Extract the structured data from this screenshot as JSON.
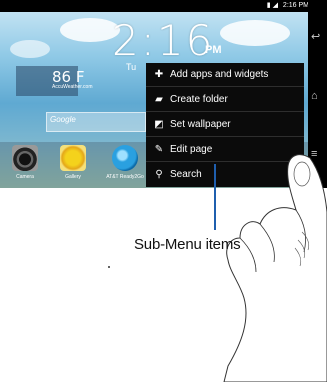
{
  "status_bar": {
    "time": "2:16 PM"
  },
  "home": {
    "clock": "2:16",
    "ampm": "PM",
    "date_fragment": "Tu",
    "temperature": "86 F",
    "weather_source": "AccuWeather.com",
    "google_label": "Google"
  },
  "dock_apps": [
    {
      "label": "Camera"
    },
    {
      "label": "Gallery"
    },
    {
      "label": "AT&T Ready2Go"
    }
  ],
  "menu": {
    "items": [
      {
        "label": "Add apps and widgets",
        "icon": "plus-icon"
      },
      {
        "label": "Create folder",
        "icon": "folder-icon"
      },
      {
        "label": "Set wallpaper",
        "icon": "wallpaper-icon"
      },
      {
        "label": "Edit page",
        "icon": "edit-icon"
      },
      {
        "label": "Search",
        "icon": "search-icon"
      }
    ]
  },
  "callout": {
    "label": "Sub-Menu items",
    "color": "#1f5fae"
  }
}
